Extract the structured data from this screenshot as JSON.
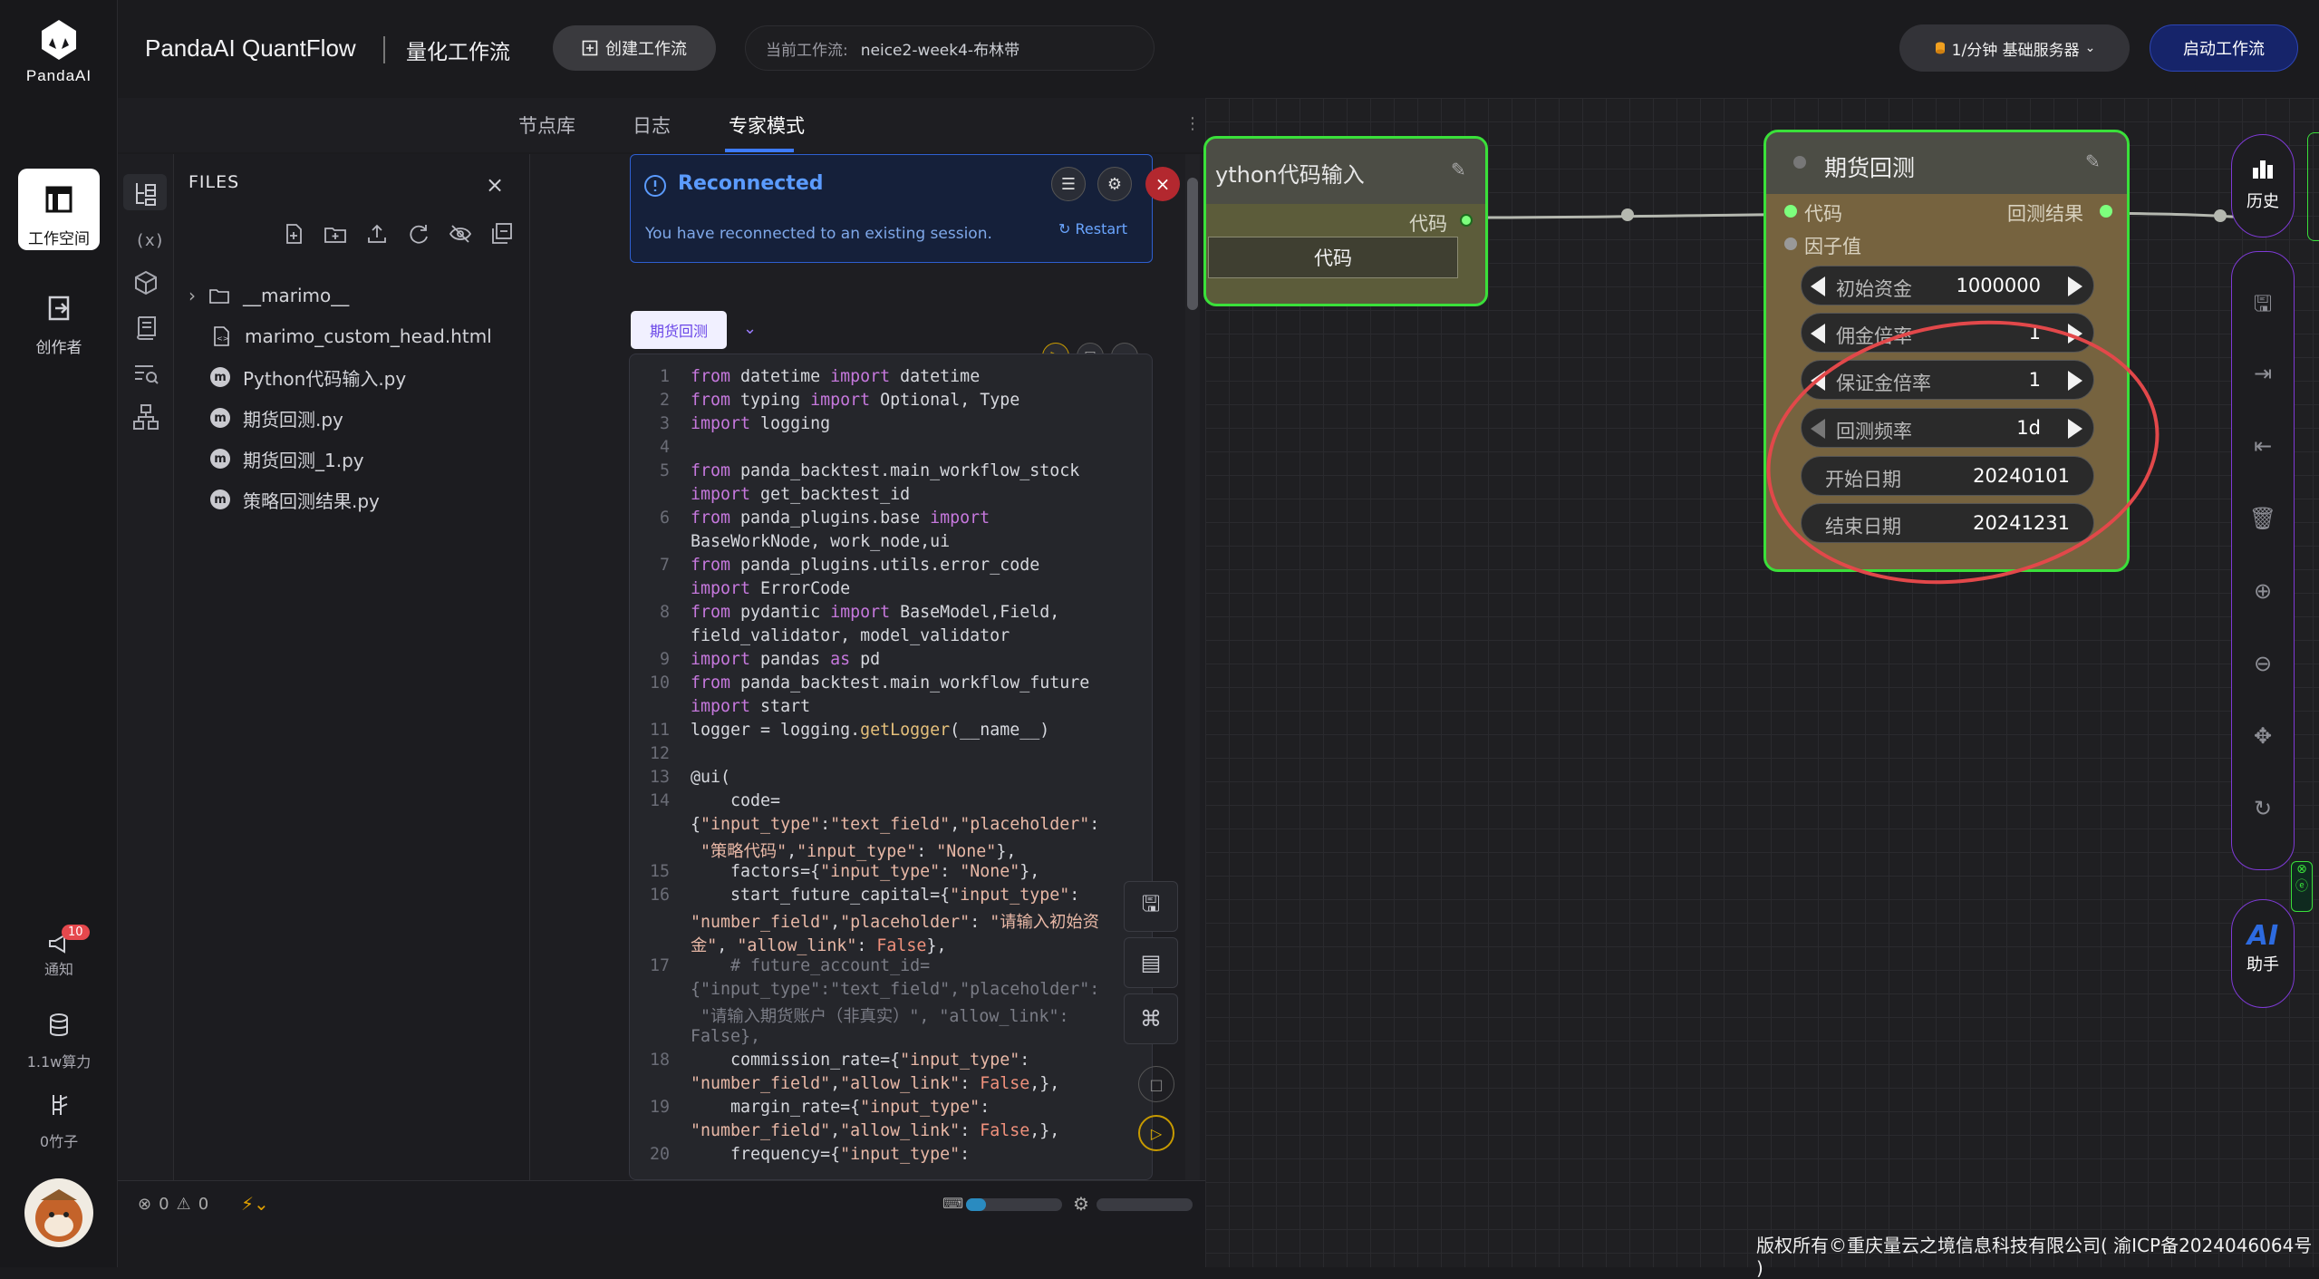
{
  "rail": {
    "logo_label": "PandaAI",
    "workspace_label": "工作空间",
    "creator_label": "创作者",
    "notify_label": "通知",
    "notify_badge": "10",
    "compute_label": "1.1w算力",
    "bamboo_label": "0竹子"
  },
  "topbar": {
    "brand": "PandaAI QuantFlow",
    "subtitle": "量化工作流",
    "create_button": "创建工作流",
    "current_label": "当前工作流:",
    "current_value": "neice2-week4-布林带",
    "server_label": "1/分钟  基础服务器",
    "launch_button": "启动工作流"
  },
  "tabs": [
    "节点库",
    "日志",
    "专家模式"
  ],
  "files": {
    "title": "FILES",
    "items": [
      {
        "name": "__marimo__",
        "type": "folder"
      },
      {
        "name": "marimo_custom_head.html",
        "type": "html"
      },
      {
        "name": "Python代码输入.py",
        "type": "marimo"
      },
      {
        "name": "期货回测.py",
        "type": "marimo"
      },
      {
        "name": "期货回测_1.py",
        "type": "marimo"
      },
      {
        "name": "策略回测结果.py",
        "type": "marimo"
      }
    ]
  },
  "reconnect": {
    "title": "Reconnected",
    "message": "You have reconnected to an existing session.",
    "restart": "Restart"
  },
  "cell": {
    "tag": "期货回测"
  },
  "status": {
    "errors": "0",
    "warnings": "0"
  },
  "nodes": {
    "python_input": {
      "title": "ython代码输入",
      "port_label": "代码",
      "field_value": "代码"
    },
    "backtest": {
      "title": "期货回测",
      "in_code": "代码",
      "in_factor": "因子值",
      "out_result": "回测结果",
      "params": [
        {
          "name": "初始资金",
          "value": "1000000"
        },
        {
          "name": "佣金倍率",
          "value": "1"
        },
        {
          "name": "保证金倍率",
          "value": "1"
        },
        {
          "name": "回测频率",
          "value": "1d"
        },
        {
          "name": "开始日期",
          "value": "20240101"
        },
        {
          "name": "结束日期",
          "value": "20241231"
        }
      ]
    }
  },
  "toolbar": {
    "history_label": "历史",
    "ai_label": "AI",
    "ai_sub": "助手"
  },
  "footer": "版权所有©重庆量云之境信息科技有限公司( 渝ICP备2024046064号 )",
  "colors": {
    "accent": "#3d7bff",
    "node_border": "#3ae03a",
    "annotation": "#e2484a",
    "launch": "#16246a"
  }
}
